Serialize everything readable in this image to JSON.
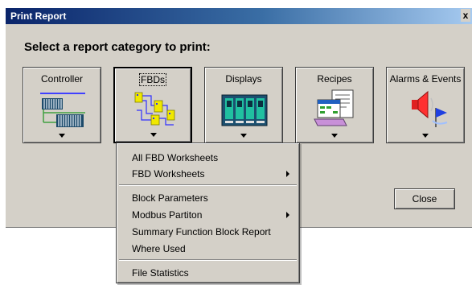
{
  "window": {
    "title": "Print Report",
    "close_glyph": "x"
  },
  "heading": "Select a report category to print:",
  "categories": [
    {
      "label": "Controller",
      "icon": "controller-rack-icon"
    },
    {
      "label": "FBDs",
      "icon": "fbd-diagram-icon",
      "pressed": true
    },
    {
      "label": "Displays",
      "icon": "displays-panel-icon"
    },
    {
      "label": "Recipes",
      "icon": "recipes-document-icon"
    },
    {
      "label": "Alarms & Events",
      "icon": "alarm-speaker-flag-icon"
    }
  ],
  "close_button": "Close",
  "menu": {
    "items": [
      {
        "label": "All FBD Worksheets"
      },
      {
        "label": "FBD Worksheets",
        "submenu": true
      },
      {
        "label": "Block Parameters"
      },
      {
        "label": "Modbus Partiton",
        "submenu": true
      },
      {
        "label": "Summary Function Block Report"
      },
      {
        "label": "Where Used"
      },
      {
        "label": "File Statistics"
      }
    ]
  }
}
